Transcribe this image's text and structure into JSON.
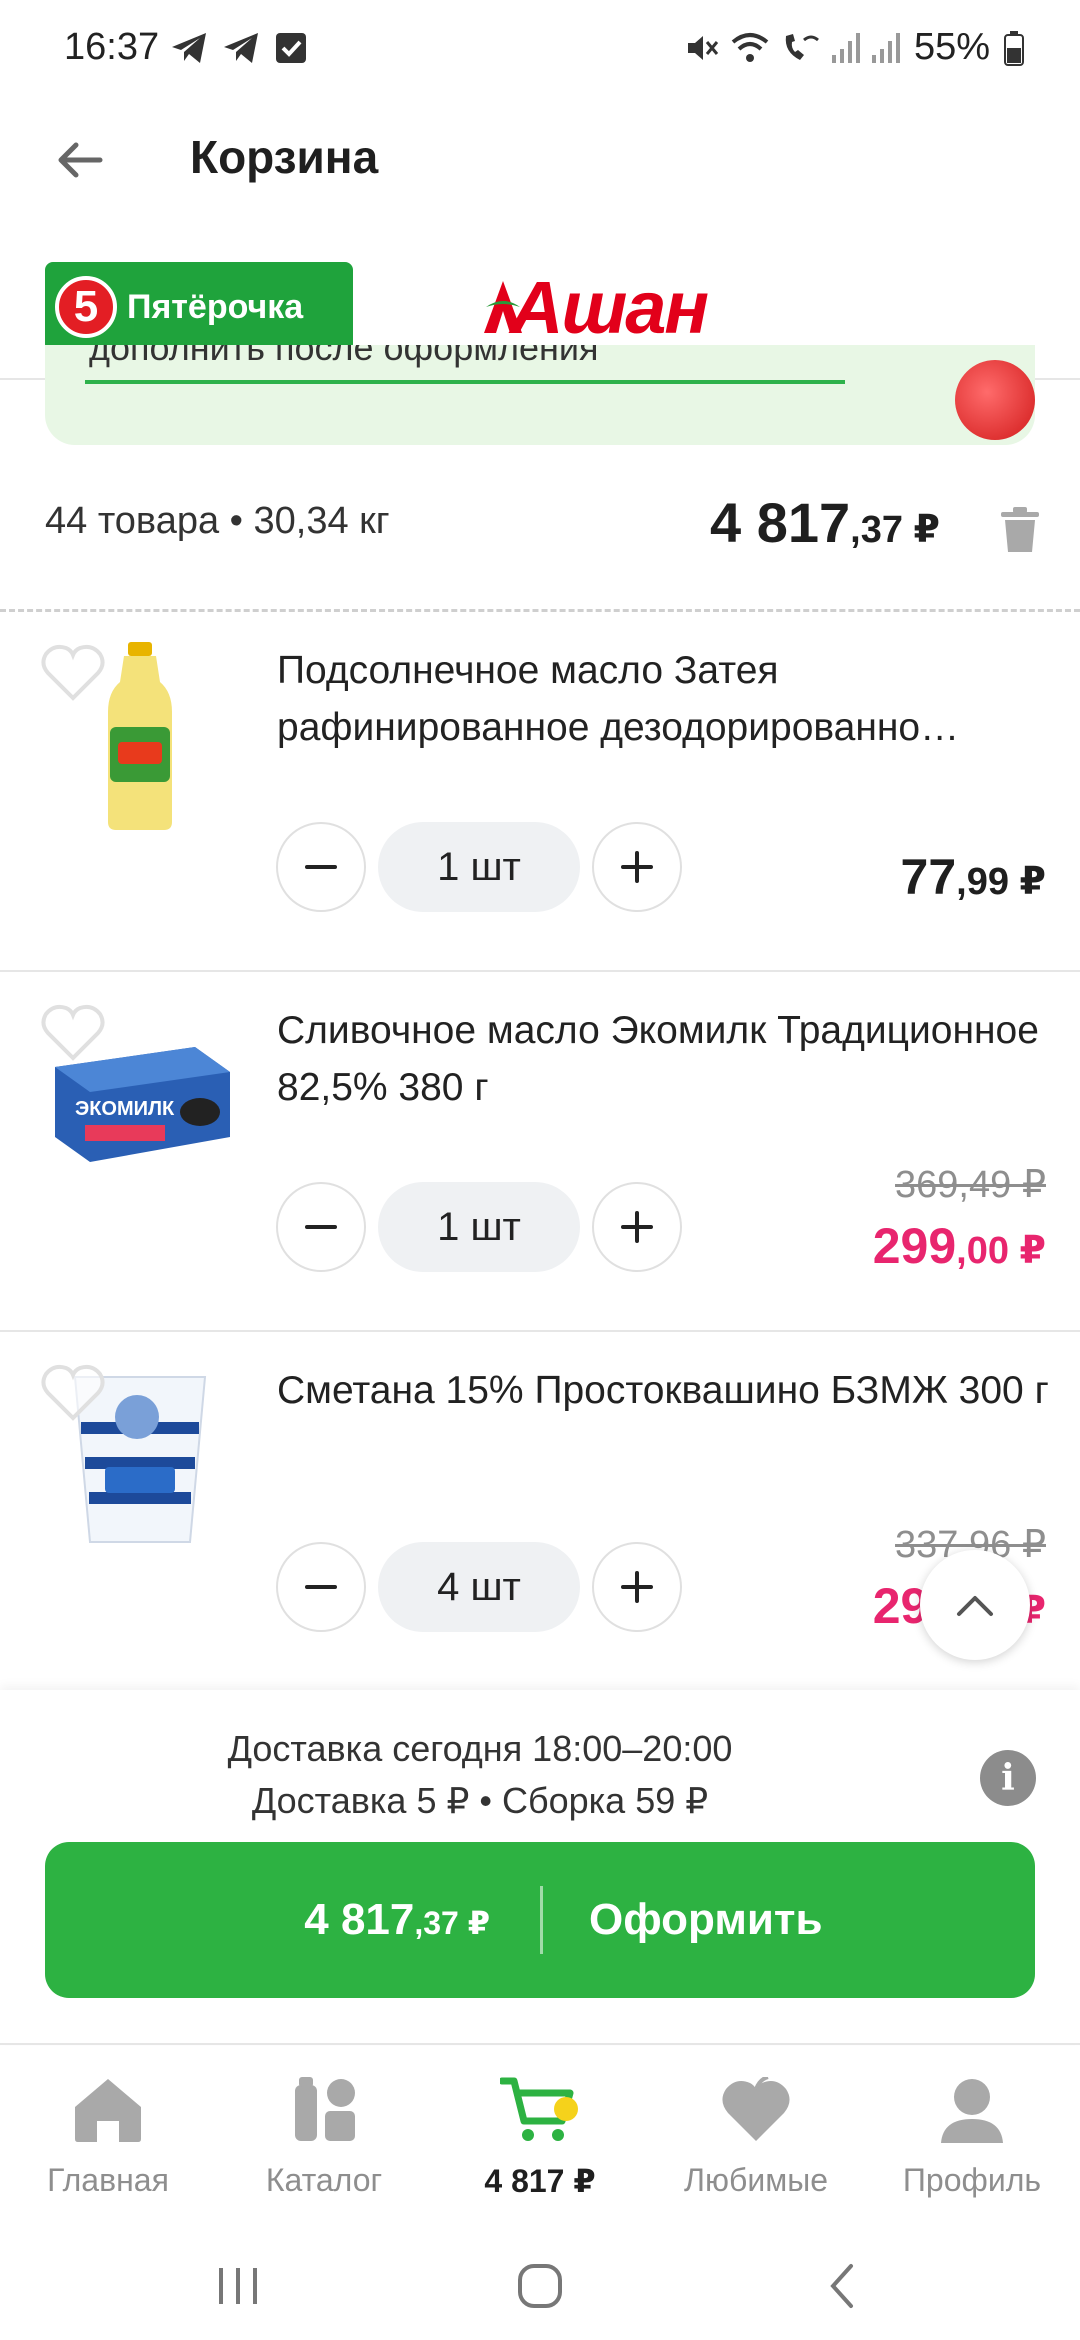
{
  "status_bar": {
    "time": "16:37",
    "battery": "55%",
    "left_icons": [
      "telegram-icon",
      "telegram-icon",
      "checkbox-notification-icon"
    ],
    "right_icons": [
      "mute-icon",
      "wifi-icon",
      "wifi-calling-icon",
      "signal-icon",
      "signal-icon",
      "battery-icon"
    ]
  },
  "header": {
    "title": "Корзина"
  },
  "stores": {
    "tab1": {
      "badge": "5",
      "name": "Пятёрочка"
    },
    "tab2": {
      "name": "Ашан"
    }
  },
  "promo": {
    "text": "дополнить после оформления"
  },
  "summary": {
    "count": "44 товара • 30,34 кг",
    "total_main": "4 817",
    "total_cents": ",37 ₽"
  },
  "items": [
    {
      "title": "Подсолнечное масло Затея рафинированное дезодорированно…",
      "qty": "1 шт",
      "price_old": "",
      "price_main": "77",
      "price_cents": ",99 ₽",
      "sale": false
    },
    {
      "title": "Сливочное масло Экомилк Традиционное 82,5% 380 г",
      "qty": "1 шт",
      "price_old": "369,49 ₽",
      "price_main": "299",
      "price_cents": ",00 ₽",
      "sale": true
    },
    {
      "title": "Сметана 15% Простоквашино БЗМЖ 300 г",
      "qty": "4 шт",
      "price_old": "337,96 ₽",
      "price_main": "299",
      "price_cents": ",00 ₽",
      "sale": true
    }
  ],
  "delivery": {
    "line1": "Доставка сегодня 18:00–20:00",
    "line2": "Доставка 5 ₽  •  Сборка 59 ₽"
  },
  "checkout": {
    "price_main": "4 817",
    "price_cents": ",37 ₽",
    "label": "Оформить"
  },
  "bottom_nav": {
    "home": "Главная",
    "catalog": "Каталог",
    "cart": "4 817 ₽",
    "favorites": "Любимые",
    "profile": "Профиль"
  },
  "colors": {
    "brand_green": "#2db242",
    "sale_pink": "#e8256e",
    "auchan_red": "#e2001a"
  }
}
